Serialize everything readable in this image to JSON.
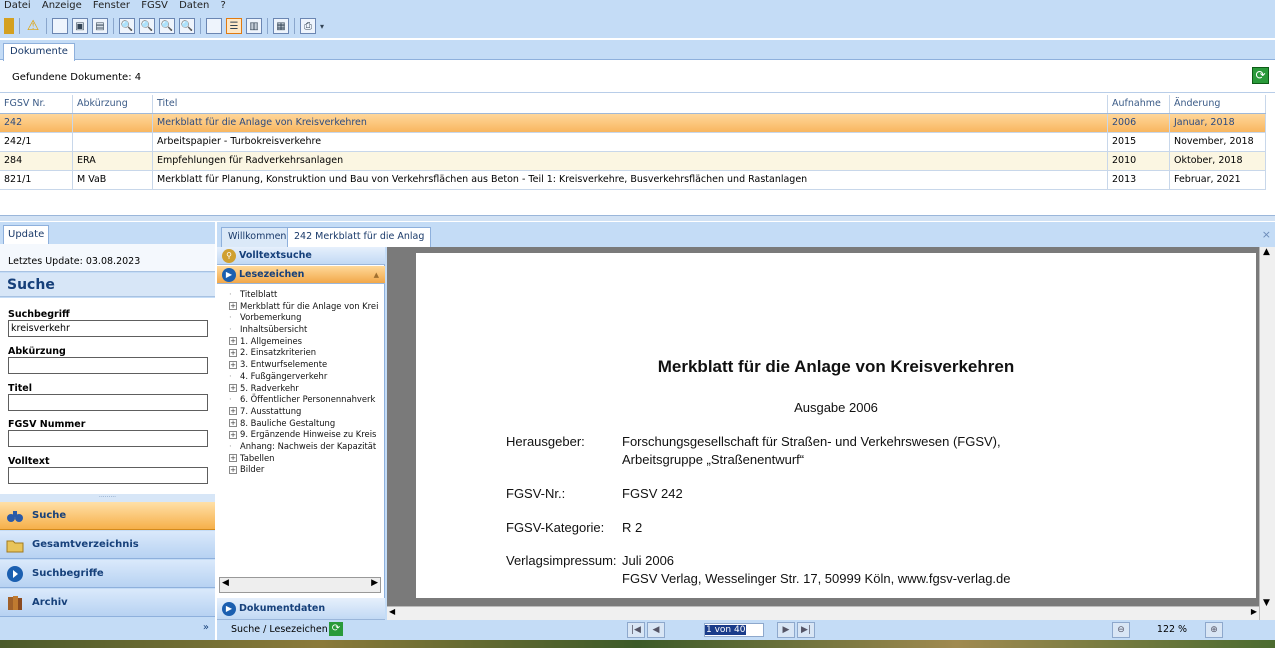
{
  "menu": [
    "Datei",
    "Anzeige",
    "Fenster",
    "FGSV",
    "Daten",
    "?"
  ],
  "doc_tab": "Dokumente",
  "found": "Gefundene Dokumente: 4",
  "table": {
    "headers": [
      "FGSV Nr.",
      "Abkürzung",
      "Titel",
      "Aufnahme",
      "Änderung"
    ],
    "rows": [
      [
        "242",
        "",
        "Merkblatt für die Anlage von Kreisverkehren",
        "2006",
        "Januar, 2018"
      ],
      [
        "242/1",
        "",
        "Arbeitspapier - Turbokreisverkehre",
        "2015",
        "November, 2018"
      ],
      [
        "284",
        "ERA",
        "Empfehlungen für Radverkehrsanlagen",
        "2010",
        "Oktober, 2018"
      ],
      [
        "821/1",
        "M VaB",
        "Merkblatt für Planung, Konstruktion und Bau von Verkehrsflächen aus Beton - Teil 1: Kreisverkehre, Busverkehrsflächen und Rastanlagen",
        "2013",
        "Februar, 2021"
      ]
    ]
  },
  "left": {
    "tab": "Update",
    "last_update": "Letztes Update: 03.08.2023",
    "title": "Suche",
    "fields": {
      "suchbegriff_label": "Suchbegriff",
      "suchbegriff_value": "kreisverkehr",
      "abk_label": "Abkürzung",
      "titel_label": "Titel",
      "nummer_label": "FGSV Nummer",
      "volltext_label": "Volltext"
    },
    "nav": [
      "Suche",
      "Gesamtverzeichnis",
      "Suchbegriffe",
      "Archiv"
    ]
  },
  "right": {
    "tabs": [
      "Willkommen",
      "242  Merkblatt für die Anlag"
    ],
    "volltext": "Volltextsuche",
    "lesezeichen": "Lesezeichen",
    "dokumentdaten": "Dokumentdaten",
    "tree": [
      {
        "label": "Titelblatt",
        "exp": false
      },
      {
        "label": "Merkblatt für die Anlage von Krei",
        "exp": true
      },
      {
        "label": "Vorbemerkung",
        "exp": false
      },
      {
        "label": "Inhaltsübersicht",
        "exp": false
      },
      {
        "label": "1. Allgemeines",
        "exp": true
      },
      {
        "label": "2. Einsatzkriterien",
        "exp": true
      },
      {
        "label": "3. Entwurfselemente",
        "exp": true
      },
      {
        "label": "4. Fußgängerverkehr",
        "exp": false
      },
      {
        "label": "5. Radverkehr",
        "exp": true
      },
      {
        "label": "6. Öffentlicher Personennahverk",
        "exp": false
      },
      {
        "label": "7. Ausstattung",
        "exp": true
      },
      {
        "label": "8. Bauliche Gestaltung",
        "exp": true
      },
      {
        "label": "9. Ergänzende Hinweise zu Kreis",
        "exp": true
      },
      {
        "label": "Anhang: Nachweis der Kapazität",
        "exp": false
      },
      {
        "label": "Tabellen",
        "exp": true
      },
      {
        "label": "Bilder",
        "exp": true
      }
    ],
    "doc": {
      "title": "Merkblatt für die Anlage von Kreisverkehren",
      "ausgabe": "Ausgabe 2006",
      "herausgeber_label": "Herausgeber:",
      "herausgeber_1": "Forschungsgesellschaft für Straßen- und Verkehrswesen (FGSV),",
      "herausgeber_2": "Arbeitsgruppe „Straßenentwurf“",
      "nr_label": "FGSV-Nr.:",
      "nr_value": "FGSV 242",
      "kat_label": "FGSV-Kategorie:",
      "kat_value": "R 2",
      "verlag_label": "Verlagsimpressum:",
      "verlag_1": "Juli 2006",
      "verlag_2": "FGSV Verlag, Wesselinger Str. 17, 50999 Köln, www.fgsv-verlag.de"
    },
    "bottom_label": "Suche / Lesezeichen",
    "page_ind": "1 von 40",
    "zoom": "122 %"
  },
  "colors": {
    "accent": "#f6b04a",
    "panel": "#c4dcf6",
    "nav": "#16407a"
  }
}
